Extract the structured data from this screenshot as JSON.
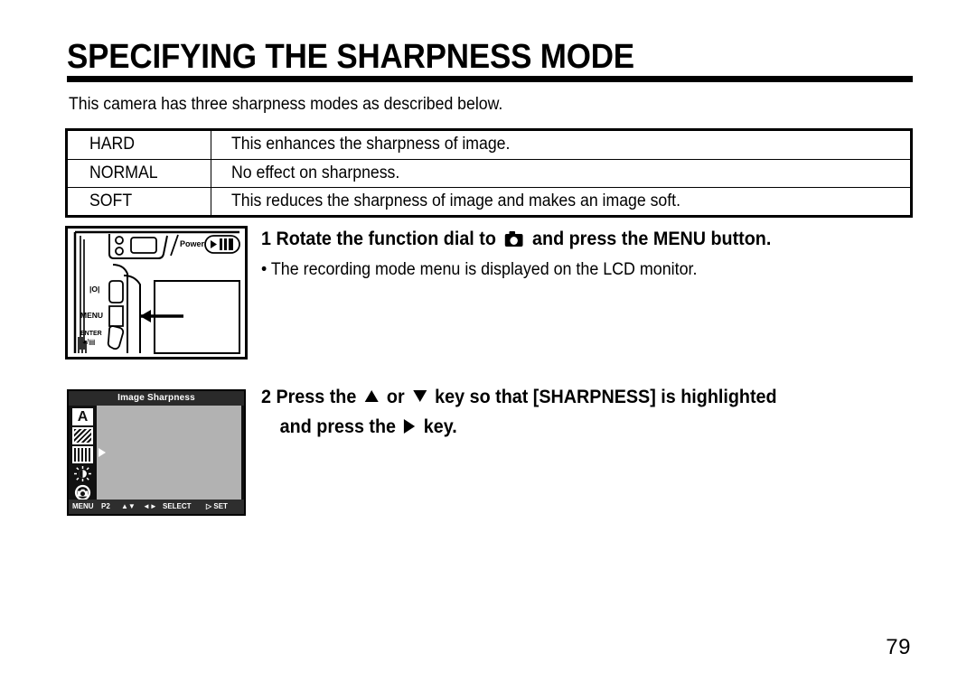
{
  "page": {
    "title": "SPECIFYING THE SHARPNESS MODE",
    "intro": "This camera has three sharpness modes as described below.",
    "page_number": "79"
  },
  "mode_table": {
    "rows": [
      {
        "mode": "HARD",
        "description": "This enhances the sharpness of image."
      },
      {
        "mode": "NORMAL",
        "description": "No effect on sharpness."
      },
      {
        "mode": "SOFT",
        "description": "This reduces the sharpness of image and makes an image soft."
      }
    ]
  },
  "figures": {
    "camera_back": {
      "power_label": "Power",
      "display_button_label": "|O|",
      "menu_button_label": "MENU",
      "enter_button_label": "ENTER",
      "enter_sub_label": "☉/▤"
    },
    "lcd_menu": {
      "title": "Image Sharpness",
      "icons": [
        {
          "name": "auto-mode-icon",
          "label": "A"
        },
        {
          "name": "image-quality-icon",
          "label": ""
        },
        {
          "name": "sharpness-icon",
          "label": ""
        },
        {
          "name": "brightness-icon",
          "label": ""
        },
        {
          "name": "camera-setup-icon",
          "label": ""
        }
      ],
      "status_bar": {
        "menu": "MENU",
        "page": "P2",
        "updown": "▲▼",
        "leftright": "◄►",
        "select": "SELECT",
        "set": "▷ SET"
      }
    }
  },
  "steps": [
    {
      "number": "1",
      "head_before": "1 Rotate the function dial to",
      "head_after": "and press the MENU button.",
      "sub": "• The recording mode menu is displayed on the LCD monitor."
    },
    {
      "number": "2",
      "line1_a": "2 Press the",
      "line1_b": "or",
      "line1_c": "key so that [SHARPNESS] is highlighted",
      "line2_a": "and press the",
      "line2_b": "key."
    }
  ]
}
